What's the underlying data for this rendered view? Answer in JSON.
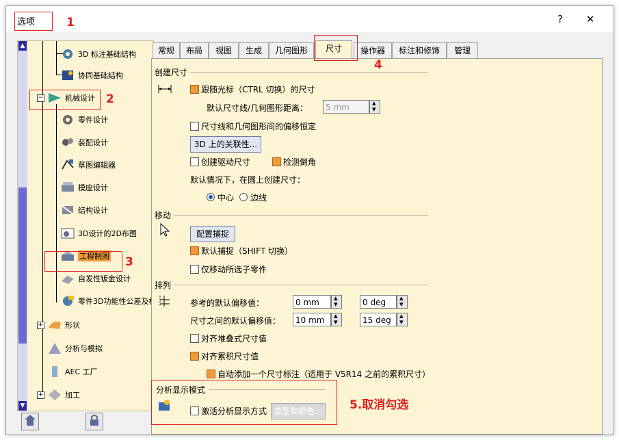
{
  "window": {
    "title": "选项",
    "help_label": "?",
    "close_label": "✕"
  },
  "tree": {
    "items": [
      {
        "label": "3D 标注基础结构",
        "icon": "gear-icon"
      },
      {
        "label": "协同基础结构",
        "icon": "collab-icon"
      },
      {
        "label": "机械设计",
        "icon": "mech-design-icon"
      },
      {
        "label": "零件设计",
        "icon": "part-gear-icon"
      },
      {
        "label": "装配设计",
        "icon": "assembly-icon"
      },
      {
        "label": "草图编辑器",
        "icon": "sketch-icon"
      },
      {
        "label": "模座设计",
        "icon": "mold-icon"
      },
      {
        "label": "结构设计",
        "icon": "structure-icon"
      },
      {
        "label": "3D设计的2D布图",
        "icon": "layout-2d-icon"
      },
      {
        "label": "工程制图",
        "icon": "drafting-icon"
      },
      {
        "label": "自发性钣金设计",
        "icon": "sheetmetal-icon"
      },
      {
        "label": "零件3D功能性公差及标",
        "icon": "tolerance-icon"
      },
      {
        "label": "形状",
        "icon": "shape-icon"
      },
      {
        "label": "分析与模拟",
        "icon": "analysis-icon"
      },
      {
        "label": "AEC 工厂",
        "icon": "aec-icon"
      },
      {
        "label": "加工",
        "icon": "machining-icon"
      }
    ]
  },
  "tabs": [
    {
      "label": "常规"
    },
    {
      "label": "布局"
    },
    {
      "label": "视图"
    },
    {
      "label": "生成"
    },
    {
      "label": "几何图形"
    },
    {
      "label": "尺寸"
    },
    {
      "label": "操作器"
    },
    {
      "label": "标注和修饰"
    },
    {
      "label": "管理"
    }
  ],
  "create_dim": {
    "group_label": "创建尺寸",
    "follow_cursor": "跟随光标（CTRL 切换）的尺寸",
    "default_distance_label": "默认尺寸线/几何图形距离：",
    "default_distance_value": "5 mm",
    "constant_offset": "尺寸线和几何图形间的偏移恒定",
    "assoc_3d_button": "3D 上的关联性...",
    "create_driving": "创建驱动尺寸",
    "detect_chamfer": "检测倒角",
    "circle_default_label": "默认情况下，在圆上创建尺寸：",
    "radio_center": "中心",
    "radio_edge": "边线"
  },
  "move": {
    "group_label": "移动",
    "snap_button": "配置捕捉",
    "default_snap": "默认捕捉（SHIFT 切换）",
    "move_selected_only": "仅移动所选子零件"
  },
  "arrange": {
    "group_label": "排列",
    "ref_offset_label": "参考的默认偏移值：",
    "ref_offset_mm": "0 mm",
    "ref_offset_deg": "0 deg",
    "between_offset_label": "尺寸之间的默认偏移值：",
    "between_offset_mm": "10 mm",
    "between_offset_deg": "15 deg",
    "align_stacked": "对齐堆叠式尺寸值",
    "align_cumulated": "对齐累积尺寸值",
    "auto_add": "自动添加一个尺寸标注（适用于 V5R14 之前的累积尺寸）"
  },
  "analysis": {
    "group_label": "分析显示模式",
    "activate": "激活分析显示方式",
    "types_colors_button": "类型和颜色..."
  },
  "annotations": {
    "n1": "1",
    "n2": "2",
    "n3": "3",
    "n4": "4",
    "n5": "5.取消勾选"
  },
  "colors": {
    "panel_bg": "#fdf4d4",
    "checked": "#ee9a3a",
    "annotation": "#e02020",
    "scroll_thumb": "#6a6ad0"
  }
}
